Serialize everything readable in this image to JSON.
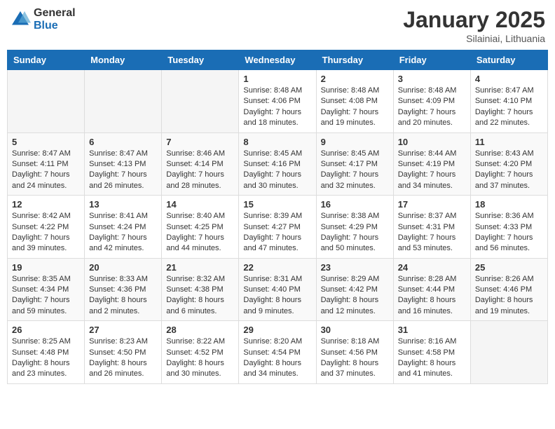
{
  "header": {
    "logo_general": "General",
    "logo_blue": "Blue",
    "month_title": "January 2025",
    "location": "Silainiai, Lithuania"
  },
  "days_of_week": [
    "Sunday",
    "Monday",
    "Tuesday",
    "Wednesday",
    "Thursday",
    "Friday",
    "Saturday"
  ],
  "weeks": [
    [
      {
        "num": "",
        "sunrise": "",
        "sunset": "",
        "daylight": ""
      },
      {
        "num": "",
        "sunrise": "",
        "sunset": "",
        "daylight": ""
      },
      {
        "num": "",
        "sunrise": "",
        "sunset": "",
        "daylight": ""
      },
      {
        "num": "1",
        "sunrise": "Sunrise: 8:48 AM",
        "sunset": "Sunset: 4:06 PM",
        "daylight": "Daylight: 7 hours and 18 minutes."
      },
      {
        "num": "2",
        "sunrise": "Sunrise: 8:48 AM",
        "sunset": "Sunset: 4:08 PM",
        "daylight": "Daylight: 7 hours and 19 minutes."
      },
      {
        "num": "3",
        "sunrise": "Sunrise: 8:48 AM",
        "sunset": "Sunset: 4:09 PM",
        "daylight": "Daylight: 7 hours and 20 minutes."
      },
      {
        "num": "4",
        "sunrise": "Sunrise: 8:47 AM",
        "sunset": "Sunset: 4:10 PM",
        "daylight": "Daylight: 7 hours and 22 minutes."
      }
    ],
    [
      {
        "num": "5",
        "sunrise": "Sunrise: 8:47 AM",
        "sunset": "Sunset: 4:11 PM",
        "daylight": "Daylight: 7 hours and 24 minutes."
      },
      {
        "num": "6",
        "sunrise": "Sunrise: 8:47 AM",
        "sunset": "Sunset: 4:13 PM",
        "daylight": "Daylight: 7 hours and 26 minutes."
      },
      {
        "num": "7",
        "sunrise": "Sunrise: 8:46 AM",
        "sunset": "Sunset: 4:14 PM",
        "daylight": "Daylight: 7 hours and 28 minutes."
      },
      {
        "num": "8",
        "sunrise": "Sunrise: 8:45 AM",
        "sunset": "Sunset: 4:16 PM",
        "daylight": "Daylight: 7 hours and 30 minutes."
      },
      {
        "num": "9",
        "sunrise": "Sunrise: 8:45 AM",
        "sunset": "Sunset: 4:17 PM",
        "daylight": "Daylight: 7 hours and 32 minutes."
      },
      {
        "num": "10",
        "sunrise": "Sunrise: 8:44 AM",
        "sunset": "Sunset: 4:19 PM",
        "daylight": "Daylight: 7 hours and 34 minutes."
      },
      {
        "num": "11",
        "sunrise": "Sunrise: 8:43 AM",
        "sunset": "Sunset: 4:20 PM",
        "daylight": "Daylight: 7 hours and 37 minutes."
      }
    ],
    [
      {
        "num": "12",
        "sunrise": "Sunrise: 8:42 AM",
        "sunset": "Sunset: 4:22 PM",
        "daylight": "Daylight: 7 hours and 39 minutes."
      },
      {
        "num": "13",
        "sunrise": "Sunrise: 8:41 AM",
        "sunset": "Sunset: 4:24 PM",
        "daylight": "Daylight: 7 hours and 42 minutes."
      },
      {
        "num": "14",
        "sunrise": "Sunrise: 8:40 AM",
        "sunset": "Sunset: 4:25 PM",
        "daylight": "Daylight: 7 hours and 44 minutes."
      },
      {
        "num": "15",
        "sunrise": "Sunrise: 8:39 AM",
        "sunset": "Sunset: 4:27 PM",
        "daylight": "Daylight: 7 hours and 47 minutes."
      },
      {
        "num": "16",
        "sunrise": "Sunrise: 8:38 AM",
        "sunset": "Sunset: 4:29 PM",
        "daylight": "Daylight: 7 hours and 50 minutes."
      },
      {
        "num": "17",
        "sunrise": "Sunrise: 8:37 AM",
        "sunset": "Sunset: 4:31 PM",
        "daylight": "Daylight: 7 hours and 53 minutes."
      },
      {
        "num": "18",
        "sunrise": "Sunrise: 8:36 AM",
        "sunset": "Sunset: 4:33 PM",
        "daylight": "Daylight: 7 hours and 56 minutes."
      }
    ],
    [
      {
        "num": "19",
        "sunrise": "Sunrise: 8:35 AM",
        "sunset": "Sunset: 4:34 PM",
        "daylight": "Daylight: 7 hours and 59 minutes."
      },
      {
        "num": "20",
        "sunrise": "Sunrise: 8:33 AM",
        "sunset": "Sunset: 4:36 PM",
        "daylight": "Daylight: 8 hours and 2 minutes."
      },
      {
        "num": "21",
        "sunrise": "Sunrise: 8:32 AM",
        "sunset": "Sunset: 4:38 PM",
        "daylight": "Daylight: 8 hours and 6 minutes."
      },
      {
        "num": "22",
        "sunrise": "Sunrise: 8:31 AM",
        "sunset": "Sunset: 4:40 PM",
        "daylight": "Daylight: 8 hours and 9 minutes."
      },
      {
        "num": "23",
        "sunrise": "Sunrise: 8:29 AM",
        "sunset": "Sunset: 4:42 PM",
        "daylight": "Daylight: 8 hours and 12 minutes."
      },
      {
        "num": "24",
        "sunrise": "Sunrise: 8:28 AM",
        "sunset": "Sunset: 4:44 PM",
        "daylight": "Daylight: 8 hours and 16 minutes."
      },
      {
        "num": "25",
        "sunrise": "Sunrise: 8:26 AM",
        "sunset": "Sunset: 4:46 PM",
        "daylight": "Daylight: 8 hours and 19 minutes."
      }
    ],
    [
      {
        "num": "26",
        "sunrise": "Sunrise: 8:25 AM",
        "sunset": "Sunset: 4:48 PM",
        "daylight": "Daylight: 8 hours and 23 minutes."
      },
      {
        "num": "27",
        "sunrise": "Sunrise: 8:23 AM",
        "sunset": "Sunset: 4:50 PM",
        "daylight": "Daylight: 8 hours and 26 minutes."
      },
      {
        "num": "28",
        "sunrise": "Sunrise: 8:22 AM",
        "sunset": "Sunset: 4:52 PM",
        "daylight": "Daylight: 8 hours and 30 minutes."
      },
      {
        "num": "29",
        "sunrise": "Sunrise: 8:20 AM",
        "sunset": "Sunset: 4:54 PM",
        "daylight": "Daylight: 8 hours and 34 minutes."
      },
      {
        "num": "30",
        "sunrise": "Sunrise: 8:18 AM",
        "sunset": "Sunset: 4:56 PM",
        "daylight": "Daylight: 8 hours and 37 minutes."
      },
      {
        "num": "31",
        "sunrise": "Sunrise: 8:16 AM",
        "sunset": "Sunset: 4:58 PM",
        "daylight": "Daylight: 8 hours and 41 minutes."
      },
      {
        "num": "",
        "sunrise": "",
        "sunset": "",
        "daylight": ""
      }
    ]
  ]
}
